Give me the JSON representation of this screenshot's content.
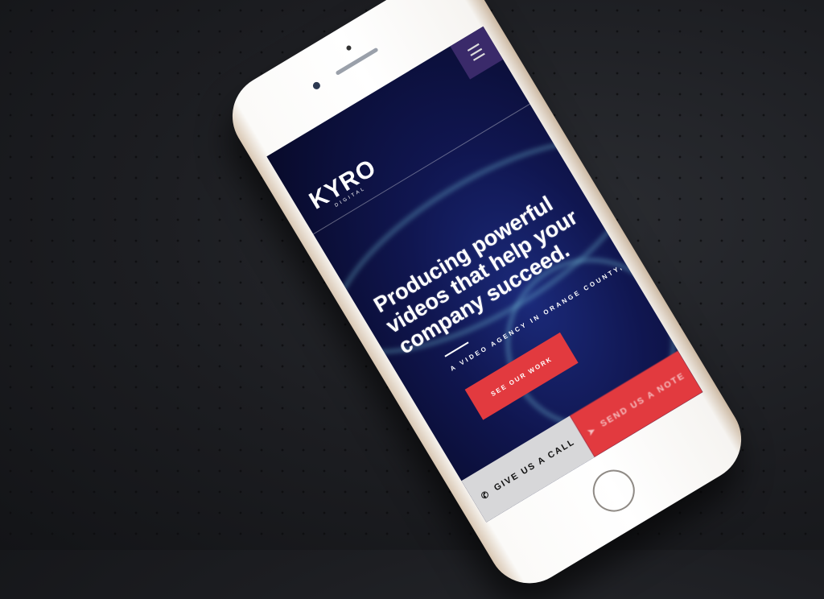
{
  "site": {
    "logo": "KYRO",
    "logo_sub": "DIGITAL",
    "menu_icon": "hamburger-icon",
    "headline": "Producing powerful videos that help your company succeed.",
    "subtitle": "A VIDEO AGENCY IN ORANGE COUNTY, CA",
    "cta_label": "SEE OUR WORK",
    "call_label": "GIVE US A CALL",
    "note_label": "SEND US A NOTE"
  },
  "colors": {
    "accent": "#e23a3f",
    "background": "#101650",
    "menu": "#3a2a6a"
  }
}
